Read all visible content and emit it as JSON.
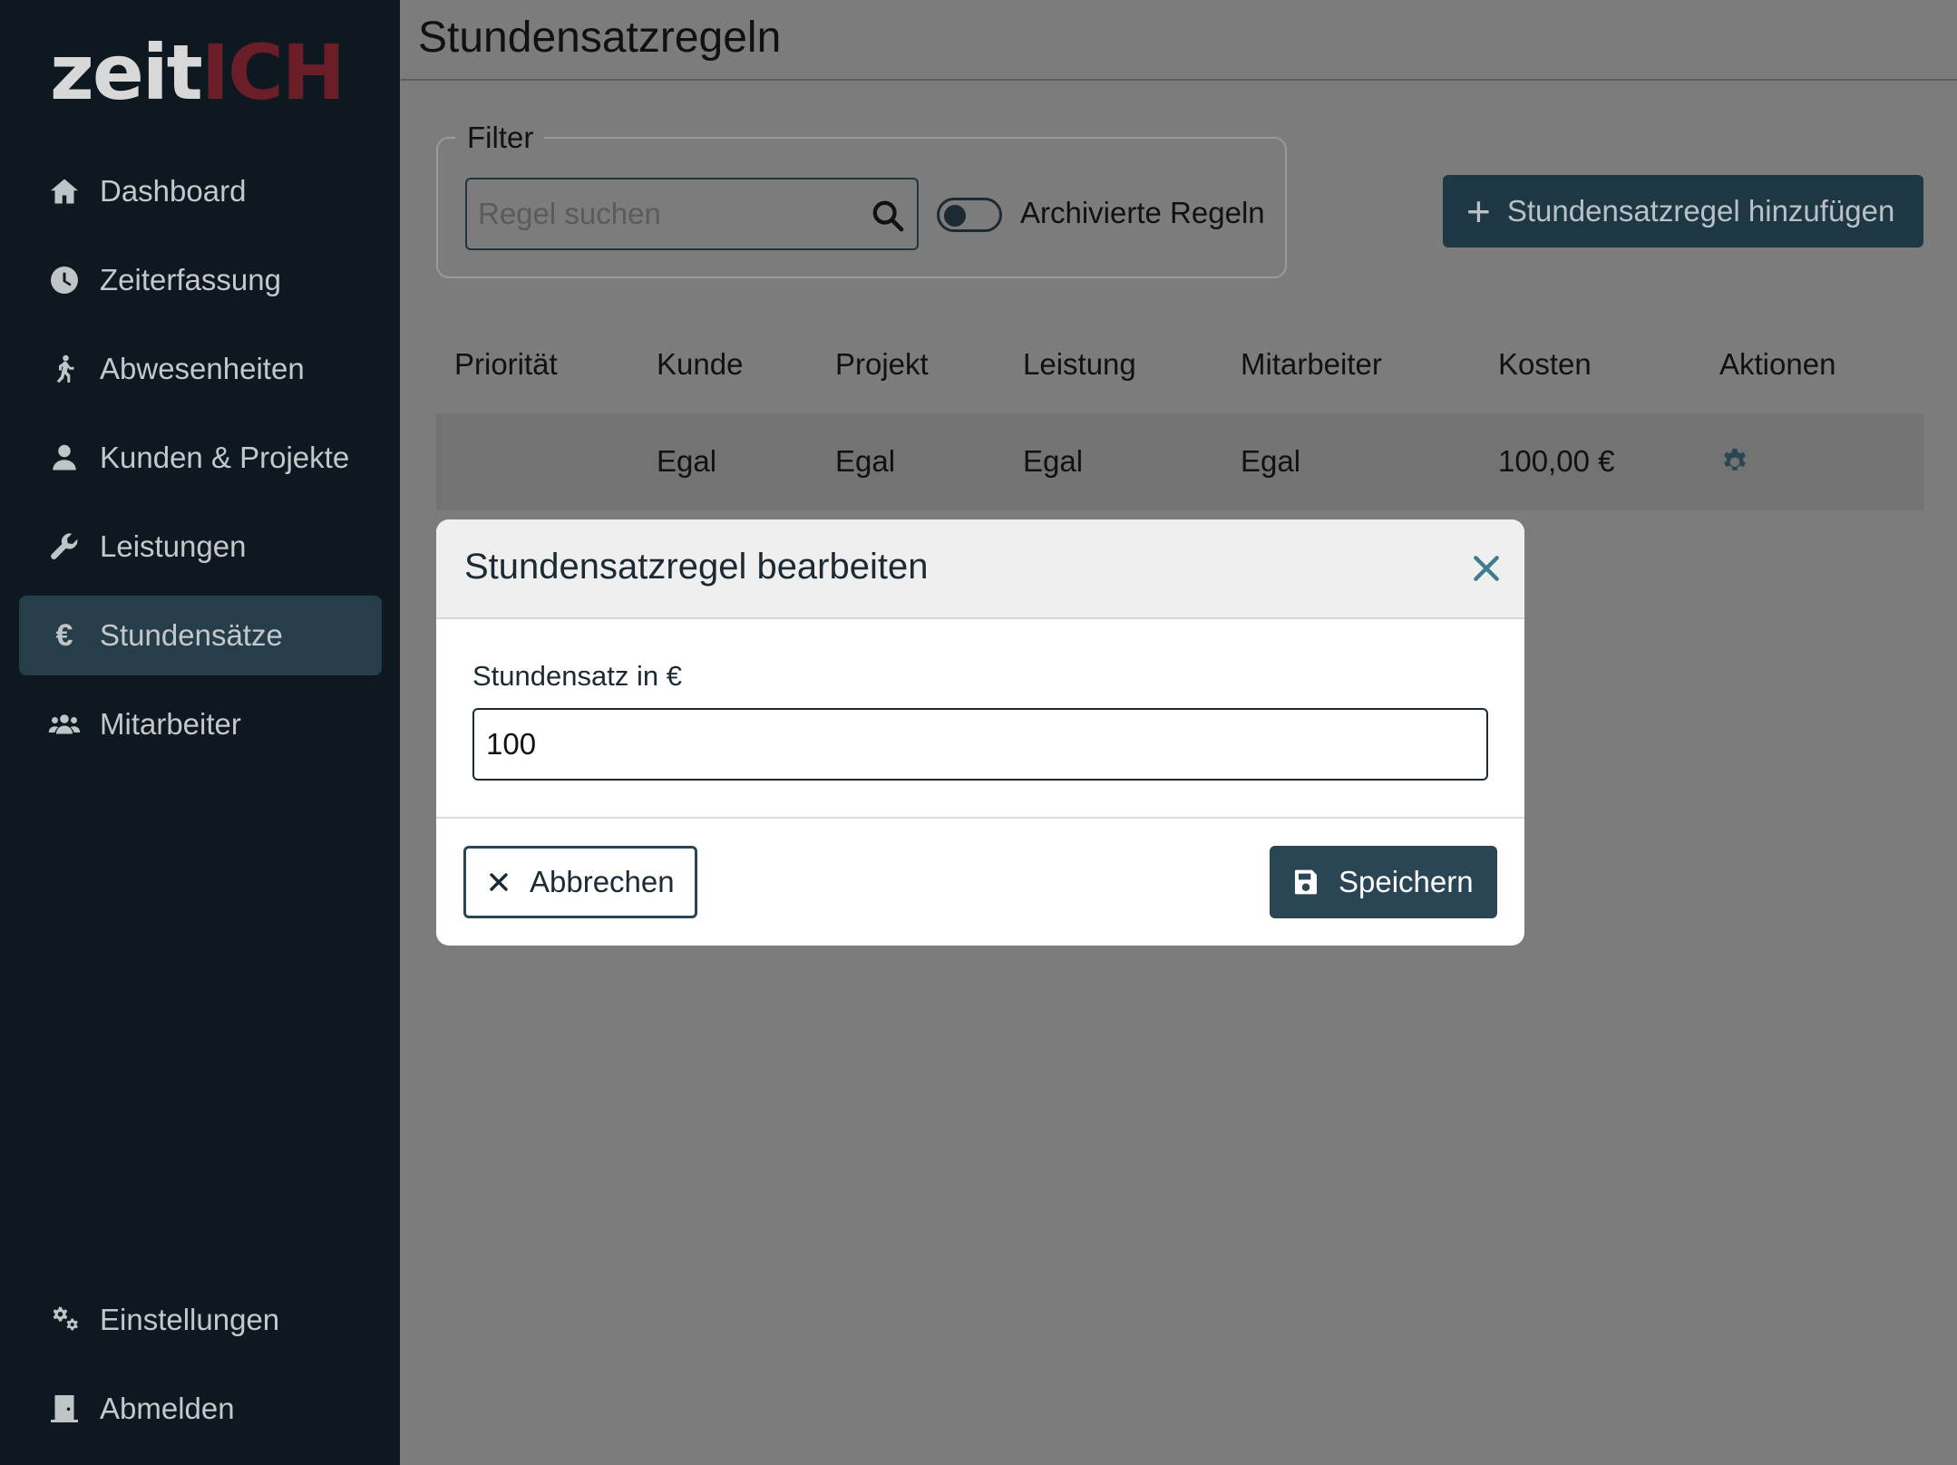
{
  "logo": {
    "part1": "zeit",
    "part2": "ICH"
  },
  "sidebar": {
    "items": [
      {
        "label": "Dashboard",
        "icon": "home-icon"
      },
      {
        "label": "Zeiterfassung",
        "icon": "clock-icon"
      },
      {
        "label": "Abwesenheiten",
        "icon": "walking-icon"
      },
      {
        "label": "Kunden & Projekte",
        "icon": "user-icon"
      },
      {
        "label": "Leistungen",
        "icon": "wrench-icon"
      },
      {
        "label": "Stundensätze",
        "icon": "euro-icon",
        "active": true
      },
      {
        "label": "Mitarbeiter",
        "icon": "users-icon"
      }
    ],
    "bottom": [
      {
        "label": "Einstellungen",
        "icon": "cogs-icon"
      },
      {
        "label": "Abmelden",
        "icon": "door-icon"
      }
    ]
  },
  "page": {
    "title": "Stundensatzregeln"
  },
  "filter": {
    "legend": "Filter",
    "search_placeholder": "Regel suchen",
    "toggle_label": "Archivierte Regeln",
    "toggle_on": false
  },
  "add_button": {
    "label": "Stundensatzregel hinzufügen"
  },
  "table": {
    "headers": [
      "Priorität",
      "Kunde",
      "Projekt",
      "Leistung",
      "Mitarbeiter",
      "Kosten",
      "Aktionen"
    ],
    "rows": [
      {
        "prioritaet": "",
        "kunde": "Egal",
        "projekt": "Egal",
        "leistung": "Egal",
        "mitarbeiter": "Egal",
        "kosten": "100,00 €"
      }
    ]
  },
  "modal": {
    "title": "Stundensatzregel bearbeiten",
    "field_label": "Stundensatz in €",
    "field_value": "100",
    "cancel_label": "Abbrechen",
    "save_label": "Speichern"
  },
  "colors": {
    "sidebar_bg": "#0e1820",
    "active_item": "#263e4a",
    "primary": "#2a4654",
    "logo_red": "#6b1d28",
    "overlay_bg": "#7c7c7c"
  }
}
